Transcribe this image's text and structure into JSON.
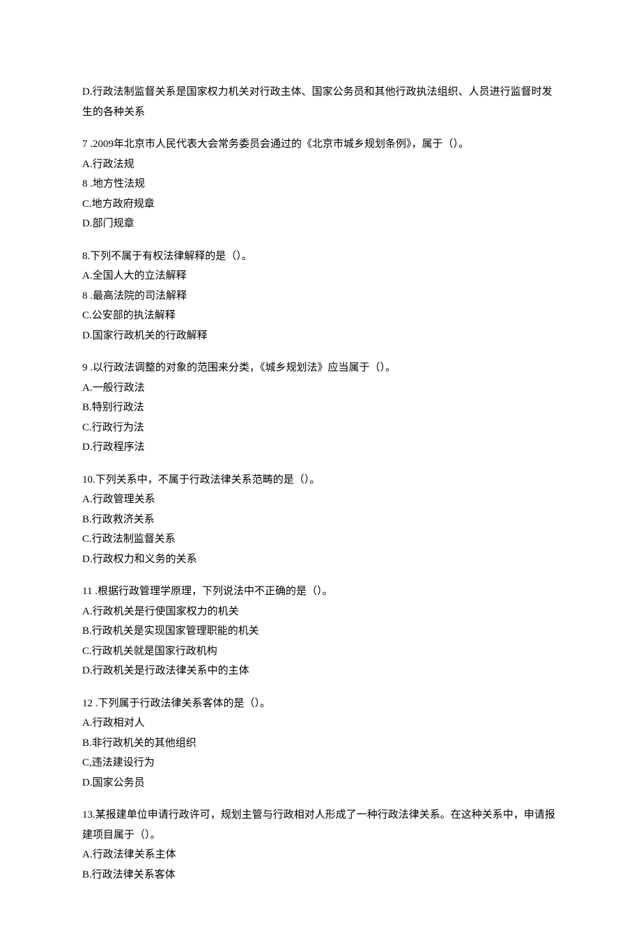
{
  "intro_lines": [
    "D.行政法制监督关系是国家权力机关对行政主体、国家公务员和其他行政执法组织、人员进行监督时发生的各种关系"
  ],
  "questions": [
    {
      "stem": "7 .2009年北京市人民代表大会常务委员会通过的《北京市城乡规划条例》，属于（）。",
      "options": [
        "A.行政法规",
        "8 .地方性法规",
        "C.地方政府规章",
        "D.部门规章"
      ]
    },
    {
      "stem": "8.下列不属于有权法律解释的是（）。",
      "options": [
        "A.全国人大的立法解释",
        "8 .最高法院的司法解释",
        "C.公安部的执法解释",
        "D.国家行政机关的行政解释"
      ]
    },
    {
      "stem": "9 .以行政法调整的对象的范围来分类，《城乡规划法》应当属于（）。",
      "options": [
        "A.一般行政法",
        "B.特别行政法",
        "C.行政行为法",
        "D.行政程序法"
      ]
    },
    {
      "stem": "10.下列关系中，不属于行政法律关系范畴的是（）。",
      "options": [
        "A.行政管理关系",
        "B.行政救济关系",
        "C.行政法制监督关系",
        "D.行政权力和义务的关系"
      ]
    },
    {
      "stem": "11 .根据行政管理学原理，下列说法中不正确的是（）。",
      "options": [
        "A.行政机关是行使国家权力的机关",
        "B.行政机关是实现国家管理职能的机关",
        "C.行政机关就是国家行政机构",
        "D.行政机关是行政法律关系中的主体"
      ]
    },
    {
      "stem": "12 .下列属于行政法律关系客体的是（）。",
      "options": [
        "A.行政相对人",
        "B.非行政机关的其他组织",
        "C,违法建设行为",
        "D.国家公务员"
      ]
    },
    {
      "stem": "13.某报建单位申请行政许可，规划主管与行政相对人形成了一种行政法律关系。在这种关系中，申请报建项目属于（）。",
      "options": [
        "A.行政法律关系主体",
        "B.行政法律关系客体"
      ]
    }
  ]
}
